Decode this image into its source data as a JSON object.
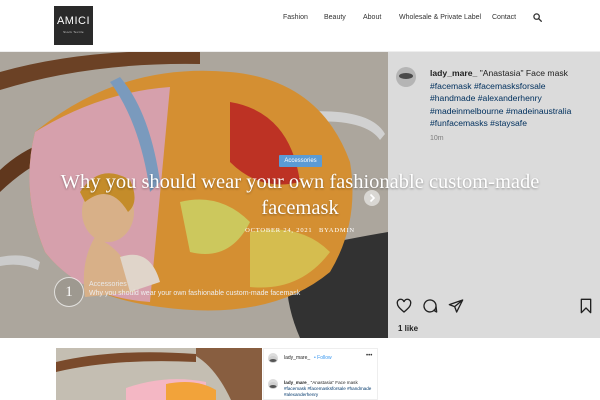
{
  "header": {
    "logo": {
      "title": "AMICI",
      "tagline": "Stock Textile"
    },
    "nav": [
      {
        "label": "Fashion"
      },
      {
        "label": "Beauty"
      },
      {
        "label": "About"
      },
      {
        "label": "Wholesale & Private Label"
      },
      {
        "label": "Contact"
      }
    ],
    "search_icon": "search-icon"
  },
  "hero": {
    "category": "Accessories",
    "title": "Why you should wear your own fashionable custom-made facemask",
    "date": "OCTOBER 24, 2021",
    "author_prefix": "BY",
    "author": "ADMIN",
    "accent_color": "#5b9bd5",
    "instagram": {
      "username": "lady_mare_",
      "caption": "\"Anastasia\" Face mask",
      "hashtags": "#facemask #facemasksforsale #handmade #alexanderhenry #madeinmelbourne #madeinaustralia #funfacemasks #staysafe",
      "time": "10m",
      "likes": "1 like",
      "icons": [
        "heart-icon",
        "comment-icon",
        "share-icon",
        "bookmark-icon"
      ]
    },
    "thumb": {
      "number": "1",
      "category": "Accessories",
      "title": "Why you should wear your own fashionable custom-made facemask"
    }
  },
  "lower": {
    "card": {
      "username": "lady_mare_",
      "follow": "• Follow",
      "more": "•••",
      "caption_user": "lady_mare_",
      "caption": "\"Anastasia\" Face mask",
      "hashtags": "#facemask #facemasksforsale #handmade #alexanderhenry"
    }
  }
}
